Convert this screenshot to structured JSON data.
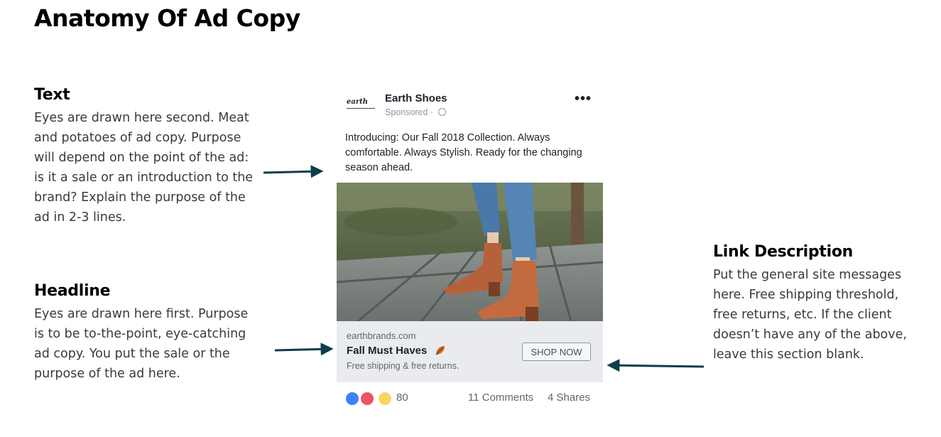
{
  "title": "Anatomy Of Ad Copy",
  "sections": {
    "text": {
      "heading": "Text",
      "body": "Eyes are drawn here second. Meat and potatoes of ad copy. Purpose will depend on the point of the ad: is it a sale or an introduction to the brand? Explain the purpose of the ad in 2-3 lines."
    },
    "headline": {
      "heading": "Headline",
      "body": "Eyes are drawn here first. Purpose is to be to-the-point, eye-catching ad copy. You put the sale or the purpose of the ad here."
    },
    "link_description": {
      "heading": "Link Description",
      "body": "Put the general site messages here. Free shipping threshold, free returns, etc. If the client doesn’t have any of the above, leave this section blank."
    }
  },
  "ad": {
    "logo_text": "earth",
    "brand": "Earth Shoes",
    "sponsored": "Sponsored ·",
    "more_icon": "ellipsis-icon",
    "intro_text": "Introducing: Our Fall 2018 Collection. Always comfortable. Always Stylish. Ready for the changing season ahead.",
    "domain": "earthbrands.com",
    "headline": "Fall Must Haves",
    "headline_icon": "fallen-leaf-icon",
    "description": "Free shipping & free returns.",
    "cta": "SHOP NOW",
    "reaction_icons": [
      "like-icon",
      "love-icon",
      "wow-icon"
    ],
    "reaction_count": "80",
    "comments": "11 Comments",
    "shares": "4 Shares"
  },
  "colors": {
    "arrow": "#0f3d4c",
    "link_area_bg": "#e9ebee"
  }
}
